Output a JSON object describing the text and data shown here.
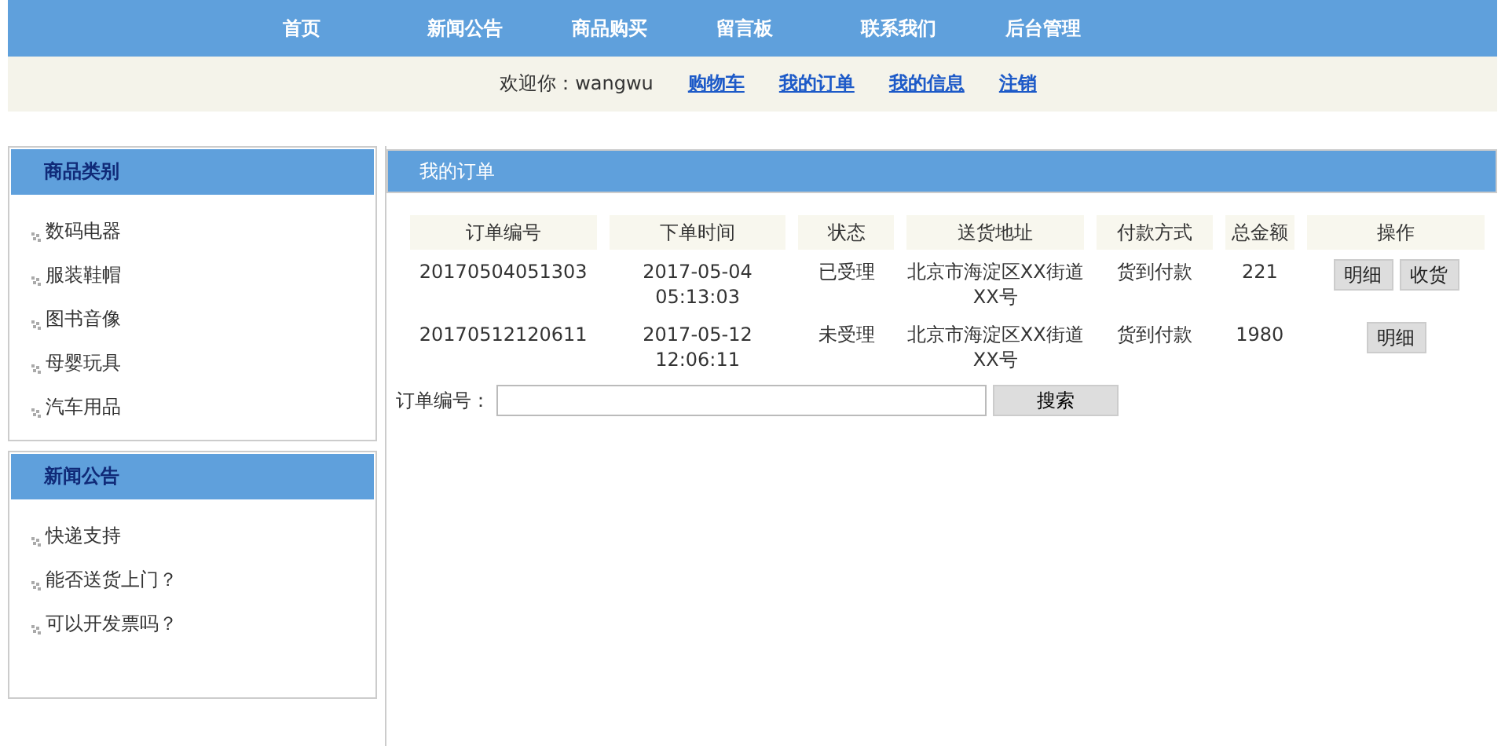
{
  "nav": [
    {
      "label": "首页"
    },
    {
      "label": "新闻公告"
    },
    {
      "label": "商品购买"
    },
    {
      "label": "留言板"
    },
    {
      "label": "联系我们"
    },
    {
      "label": "后台管理"
    }
  ],
  "welcome": {
    "greeting": "欢迎你：wangwu",
    "links": [
      "购物车",
      "我的订单",
      "我的信息",
      "注销"
    ]
  },
  "sidebar": [
    {
      "title": "商品类别",
      "items": [
        "数码电器",
        "服装鞋帽",
        "图书音像",
        "母婴玩具",
        "汽车用品"
      ]
    },
    {
      "title": "新闻公告",
      "items": [
        "快递支持",
        "能否送货上门？",
        "可以开发票吗？"
      ]
    }
  ],
  "main": {
    "title": "我的订单",
    "table": {
      "columns": [
        "订单编号",
        "下单时间",
        "状态",
        "送货地址",
        "付款方式",
        "总金额",
        "操作"
      ],
      "rows": [
        {
          "cells": [
            "20170504051303",
            "2017-05-04 05:13:03",
            "已受理",
            "北京市海淀区XX街道XX号",
            "货到付款",
            "221"
          ],
          "actions": [
            "明细",
            "收货"
          ]
        },
        {
          "cells": [
            "20170512120611",
            "2017-05-12 12:06:11",
            "未受理",
            "北京市海淀区XX街道XX号",
            "货到付款",
            "1980"
          ],
          "actions": [
            "明细"
          ]
        }
      ]
    },
    "search": {
      "label": "订单编号：",
      "button": "搜索"
    }
  }
}
